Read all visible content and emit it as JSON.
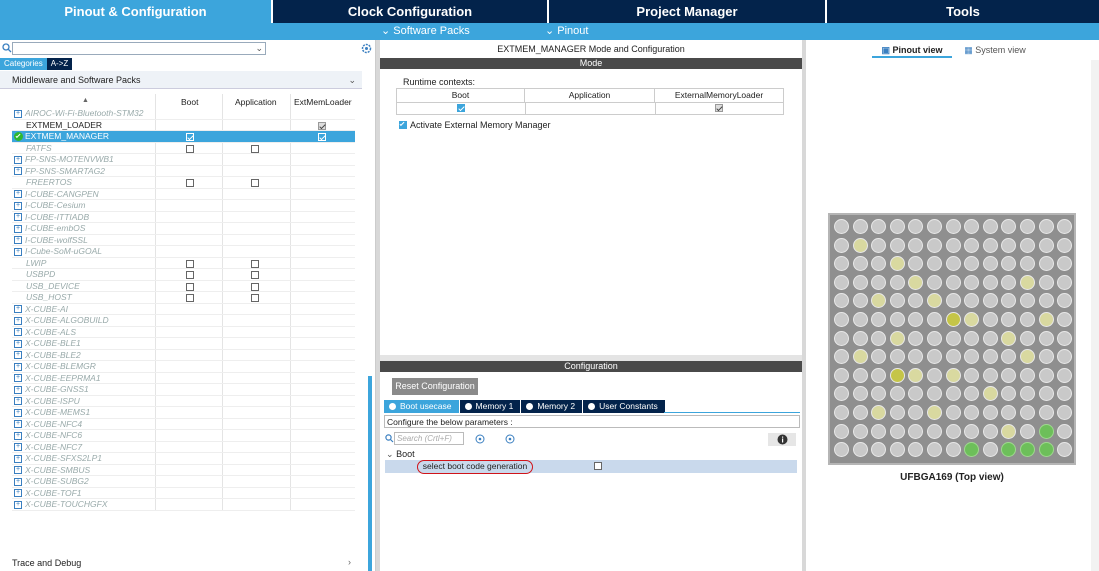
{
  "top_tabs": [
    "Pinout & Configuration",
    "Clock Configuration",
    "Project Manager",
    "Tools"
  ],
  "sub_menu": {
    "software_packs": "Software Packs",
    "pinout": "Pinout"
  },
  "left": {
    "category_tabs": [
      "Categories",
      "A->Z"
    ],
    "section_title": "Middleware and Software Packs",
    "columns": [
      "Boot",
      "Application",
      "ExtMemLoader"
    ],
    "sort_arrow": "▲",
    "rows": [
      {
        "name": "AIROC-Wi-Fi-Bluetooth-STM32",
        "expand": true,
        "boot": null,
        "app": null,
        "ext": null,
        "dim": true
      },
      {
        "name": "EXTMEM_LOADER",
        "expand": false,
        "boot": null,
        "app": null,
        "ext": "checked",
        "dim": false
      },
      {
        "name": "EXTMEM_MANAGER",
        "expand": false,
        "boot": "checked",
        "app": null,
        "ext": "checked",
        "dim": false,
        "selected": true
      },
      {
        "name": "FATFS",
        "expand": false,
        "boot": "unchecked",
        "app": "unchecked",
        "ext": null,
        "dim": true
      },
      {
        "name": "FP-SNS-MOTENVWB1",
        "expand": true,
        "boot": null,
        "app": null,
        "ext": null,
        "dim": true
      },
      {
        "name": "FP-SNS-SMARTAG2",
        "expand": true,
        "boot": null,
        "app": null,
        "ext": null,
        "dim": true
      },
      {
        "name": "FREERTOS",
        "expand": false,
        "boot": "unchecked",
        "app": "unchecked",
        "ext": null,
        "dim": true
      },
      {
        "name": "I-CUBE-CANGPEN",
        "expand": true,
        "boot": null,
        "app": null,
        "ext": null,
        "dim": true
      },
      {
        "name": "I-CUBE-Cesium",
        "expand": true,
        "boot": null,
        "app": null,
        "ext": null,
        "dim": true
      },
      {
        "name": "I-CUBE-ITTIADB",
        "expand": true,
        "boot": null,
        "app": null,
        "ext": null,
        "dim": true
      },
      {
        "name": "I-CUBE-embOS",
        "expand": true,
        "boot": null,
        "app": null,
        "ext": null,
        "dim": true
      },
      {
        "name": "I-CUBE-wolfSSL",
        "expand": true,
        "boot": null,
        "app": null,
        "ext": null,
        "dim": true
      },
      {
        "name": "I-Cube-SoM-uGOAL",
        "expand": true,
        "boot": null,
        "app": null,
        "ext": null,
        "dim": true
      },
      {
        "name": "LWIP",
        "expand": false,
        "boot": "unchecked",
        "app": "unchecked",
        "ext": null,
        "dim": true
      },
      {
        "name": "USBPD",
        "expand": false,
        "boot": "unchecked",
        "app": "unchecked",
        "ext": null,
        "dim": true
      },
      {
        "name": "USB_DEVICE",
        "expand": false,
        "boot": "unchecked",
        "app": "unchecked",
        "ext": null,
        "dim": true
      },
      {
        "name": "USB_HOST",
        "expand": false,
        "boot": "unchecked",
        "app": "unchecked",
        "ext": null,
        "dim": true
      },
      {
        "name": "X-CUBE-AI",
        "expand": true,
        "boot": null,
        "app": null,
        "ext": null,
        "dim": true
      },
      {
        "name": "X-CUBE-ALGOBUILD",
        "expand": true,
        "boot": null,
        "app": null,
        "ext": null,
        "dim": true
      },
      {
        "name": "X-CUBE-ALS",
        "expand": true,
        "boot": null,
        "app": null,
        "ext": null,
        "dim": true
      },
      {
        "name": "X-CUBE-BLE1",
        "expand": true,
        "boot": null,
        "app": null,
        "ext": null,
        "dim": true
      },
      {
        "name": "X-CUBE-BLE2",
        "expand": true,
        "boot": null,
        "app": null,
        "ext": null,
        "dim": true
      },
      {
        "name": "X-CUBE-BLEMGR",
        "expand": true,
        "boot": null,
        "app": null,
        "ext": null,
        "dim": true
      },
      {
        "name": "X-CUBE-EEPRMA1",
        "expand": true,
        "boot": null,
        "app": null,
        "ext": null,
        "dim": true
      },
      {
        "name": "X-CUBE-GNSS1",
        "expand": true,
        "boot": null,
        "app": null,
        "ext": null,
        "dim": true
      },
      {
        "name": "X-CUBE-ISPU",
        "expand": true,
        "boot": null,
        "app": null,
        "ext": null,
        "dim": true
      },
      {
        "name": "X-CUBE-MEMS1",
        "expand": true,
        "boot": null,
        "app": null,
        "ext": null,
        "dim": true
      },
      {
        "name": "X-CUBE-NFC4",
        "expand": true,
        "boot": null,
        "app": null,
        "ext": null,
        "dim": true
      },
      {
        "name": "X-CUBE-NFC6",
        "expand": true,
        "boot": null,
        "app": null,
        "ext": null,
        "dim": true
      },
      {
        "name": "X-CUBE-NFC7",
        "expand": true,
        "boot": null,
        "app": null,
        "ext": null,
        "dim": true
      },
      {
        "name": "X-CUBE-SFXS2LP1",
        "expand": true,
        "boot": null,
        "app": null,
        "ext": null,
        "dim": true
      },
      {
        "name": "X-CUBE-SMBUS",
        "expand": true,
        "boot": null,
        "app": null,
        "ext": null,
        "dim": true
      },
      {
        "name": "X-CUBE-SUBG2",
        "expand": true,
        "boot": null,
        "app": null,
        "ext": null,
        "dim": true
      },
      {
        "name": "X-CUBE-TOF1",
        "expand": true,
        "boot": null,
        "app": null,
        "ext": null,
        "dim": true
      },
      {
        "name": "X-CUBE-TOUCHGFX",
        "expand": true,
        "boot": null,
        "app": null,
        "ext": null,
        "dim": true
      }
    ],
    "trace_debug": "Trace and Debug"
  },
  "middle": {
    "title": "EXTMEM_MANAGER Mode and Configuration",
    "mode_header": "Mode",
    "runtime_contexts": "Runtime contexts:",
    "ctx_columns": [
      "Boot",
      "Application",
      "ExternalMemoryLoader"
    ],
    "activate_label": "Activate External Memory Manager",
    "config_header": "Configuration",
    "reset_button": "Reset Configuration",
    "config_tabs": [
      "Boot usecase",
      "Memory 1",
      "Memory 2",
      "User Constants"
    ],
    "configure_text": "Configure the below parameters :",
    "search_placeholder": "Search (Crtl+F)",
    "group_label": "Boot",
    "param_label": "select boot code generation"
  },
  "right": {
    "views": [
      "Pinout view",
      "System view"
    ],
    "chip_label": "UFBGA169 (Top view)"
  },
  "colors": {
    "navy": "#03234b",
    "accent": "#3ca5dc",
    "highlight_ring": "#d0141a"
  }
}
